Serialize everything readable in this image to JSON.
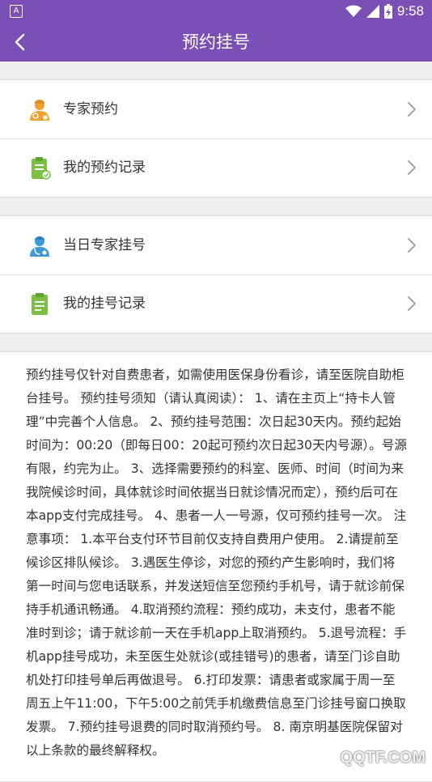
{
  "status_bar": {
    "left_icon": "A",
    "time": "9:58",
    "icons": [
      "wifi-icon",
      "signal-icon",
      "battery-charging-icon"
    ]
  },
  "app_bar": {
    "title": "预约挂号",
    "back_icon": "chevron-left-icon"
  },
  "menu_groups": [
    {
      "items": [
        {
          "label": "专家预约",
          "icon": "expert-doctor-icon"
        },
        {
          "label": "我的预约记录",
          "icon": "clipboard-check-icon"
        }
      ]
    },
    {
      "items": [
        {
          "label": "当日专家挂号",
          "icon": "doctor-icon"
        },
        {
          "label": "我的挂号记录",
          "icon": "clipboard-list-icon"
        }
      ]
    }
  ],
  "notice": {
    "text": "预约挂号仅针对自费患者，如需使用医保身份看诊，请至医院自助柜台挂号。 预约挂号须知（请认真阅读）： 1、请在主页上“持卡人管理”中完善个人信息。 2、预约挂号范围：次日起30天内。预约起始时间为：00:20（即每日00：20起可预约次日起30天内号源）。号源有限，约完为止。 3、选择需要预约的科室、医师、时间（时间为来我院候诊时间，具体就诊时间依据当日就诊情况而定），预约后可在本app支付完成挂号。 4、患者一人一号源，仅可预约挂号一次。 注意事项： 1.本平台支付环节目前仅支持自费用户使用。 2.请提前至候诊区排队候诊。 3.遇医生停诊，对您的预约产生影响时，我们将第一时间与您电话联系，并发送短信至您预约手机号，请于就诊前保持手机通讯畅通。 4.取消预约流程：预约成功，未支付，患者不能准时到诊；请于就诊前一天在手机app上取消预约。 5.退号流程：手机app挂号成功，未至医生处就诊(或挂错号)的患者，请至门诊自助机处打印挂号单后再做退号。 6.打印发票：请患者或家属于周一至周五上午11:00，下午5:00之前凭手机缴费信息至门诊挂号窗口换取发票。 7.预约挂号退费的同时取消预约号。 8. 南京明基医院保留对以上条款的最终解释权。"
  },
  "watermark": "QQTF.COM",
  "colors": {
    "primary": "#7b4fb5",
    "background": "#efeff0",
    "icon_orange": "#f0a030",
    "icon_green": "#7cc043",
    "icon_blue": "#3a9bd8"
  }
}
